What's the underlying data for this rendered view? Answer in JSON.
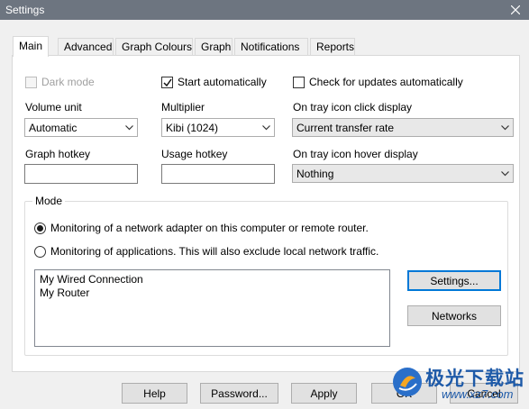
{
  "window": {
    "title": "Settings"
  },
  "tabs": [
    {
      "label": "Main",
      "active": true
    },
    {
      "label": "Advanced"
    },
    {
      "label": "Graph Colours"
    },
    {
      "label": "Graph"
    },
    {
      "label": "Notifications"
    },
    {
      "label": "Reports"
    }
  ],
  "main": {
    "dark_mode": {
      "label": "Dark mode",
      "checked": false,
      "disabled": true
    },
    "start_auto": {
      "label": "Start automatically",
      "checked": true
    },
    "check_updates": {
      "label": "Check for updates automatically",
      "checked": false
    },
    "volume_unit": {
      "label": "Volume unit",
      "value": "Automatic"
    },
    "multiplier": {
      "label": "Multiplier",
      "value": "Kibi (1024)"
    },
    "tray_click": {
      "label": "On tray icon click display",
      "value": "Current transfer rate"
    },
    "graph_hotkey": {
      "label": "Graph hotkey",
      "value": ""
    },
    "usage_hotkey": {
      "label": "Usage hotkey",
      "value": ""
    },
    "tray_hover": {
      "label": "On tray icon hover display",
      "value": "Nothing"
    },
    "mode": {
      "legend": "Mode",
      "option_adapter": "Monitoring of a network adapter on this computer or remote router.",
      "option_apps": "Monitoring of applications. This will also exclude local network traffic.",
      "selected": "adapter",
      "connections": [
        "My Wired Connection",
        "My Router"
      ],
      "settings_button": "Settings...",
      "networks_button": "Networks"
    }
  },
  "footer": {
    "help": "Help",
    "password": "Password...",
    "apply": "Apply",
    "ok": "OK",
    "cancel": "Cancel"
  },
  "watermark": {
    "text": "极光下载站",
    "sub": "www.xz7.com"
  }
}
